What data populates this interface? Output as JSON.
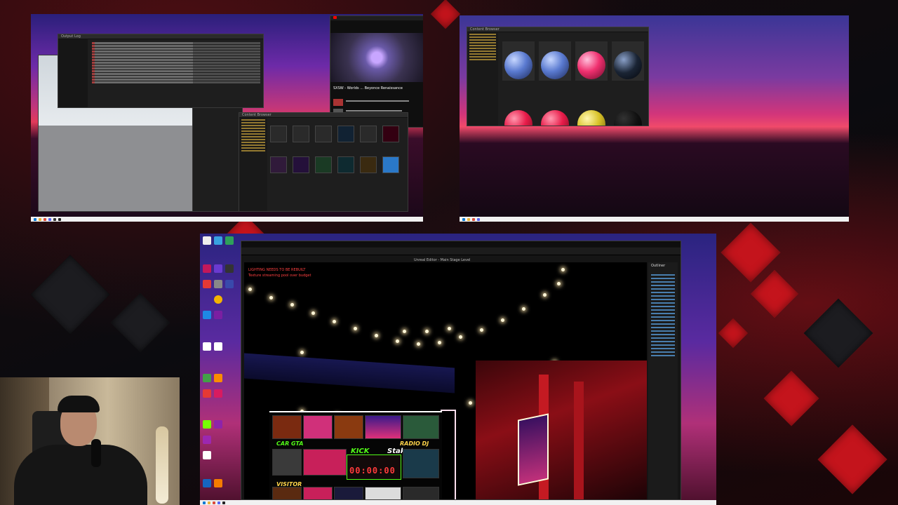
{
  "monitor_left": {
    "youtube": {
      "title": "SXSW - Worlds ... Beyonce Renaissance",
      "sub": "Renaissance"
    },
    "output_log": {
      "title": "Output Log"
    },
    "content_browser": {
      "title": "Content Browser"
    }
  },
  "monitor_right": {
    "material_browser": {
      "title": "Content Browser"
    }
  },
  "monitor_bottom": {
    "editor_title": "Unreal Editor - Main Stage Level",
    "viewport_overlay_line1": "LIGHTING NEEDS TO BE REBUILT",
    "viewport_overlay_line2": "Texture streaming pool over budget",
    "outliner_header": "Outliner",
    "stage_screens": {
      "kick_logo": "KICK",
      "stake_logo": "Stake",
      "timer": "00:00:00",
      "left_label": "CAR GTA",
      "bottom_label": "VISITOR",
      "right_label": "RADIO DJ"
    }
  },
  "colors": {
    "accent_red": "#c4141c",
    "kick_green": "#53fc18",
    "timer_red": "#ff3b3b"
  },
  "icons": [
    "youtube-icon",
    "folder-icon",
    "unreal-icon",
    "chrome-icon",
    "discord-icon",
    "obs-icon"
  ]
}
